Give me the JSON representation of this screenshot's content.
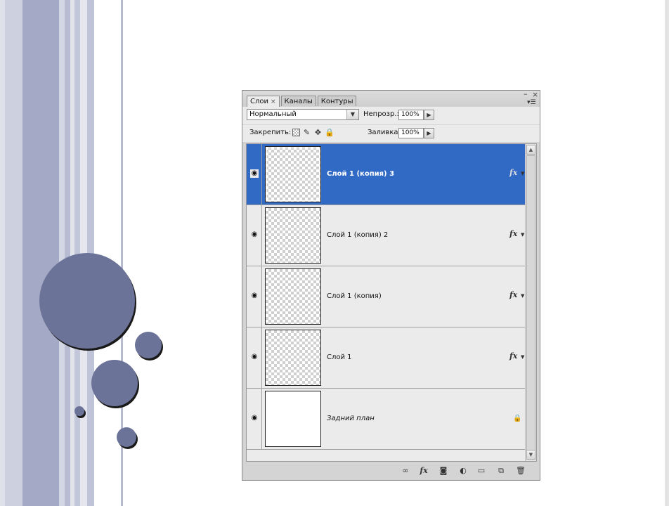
{
  "background": {
    "stripe_colors": [
      "#ccd0df",
      "#9fa4c2",
      "#7f86a8"
    ],
    "circle_color": "#6c7399"
  },
  "window_controls": {
    "minimize_icon": "minimize-icon",
    "close_icon": "close-icon"
  },
  "tabs": [
    {
      "label": "Слои",
      "active": true
    },
    {
      "label": "Каналы",
      "active": false
    },
    {
      "label": "Контуры",
      "active": false
    }
  ],
  "tab_close_glyph": "×",
  "blend_mode": {
    "value": "Нормальный"
  },
  "opacity": {
    "label": "Непрозр.:",
    "value": "100%"
  },
  "lock": {
    "label": "Закрепить:"
  },
  "fill": {
    "label": "Заливка:",
    "value": "100%"
  },
  "layers": [
    {
      "name": "Слой 1 (копия) 3",
      "selected": true,
      "fx": "fx",
      "visible": true
    },
    {
      "name": "Слой 1 (копия) 2",
      "selected": false,
      "fx": "fx",
      "visible": true
    },
    {
      "name": "Слой 1 (копия)",
      "selected": false,
      "fx": "fx",
      "visible": true
    },
    {
      "name": "Слой 1",
      "selected": false,
      "fx": "fx",
      "visible": true
    },
    {
      "name": "Задний план",
      "selected": false,
      "locked": true,
      "visible": true
    }
  ],
  "bottom_icons": [
    "link-icon",
    "fx-icon",
    "mask-icon",
    "adjustment-icon",
    "folder-icon",
    "new-layer-icon",
    "trash-icon"
  ],
  "bottom_fx_label": "fx",
  "selected_color": "#316ac5"
}
